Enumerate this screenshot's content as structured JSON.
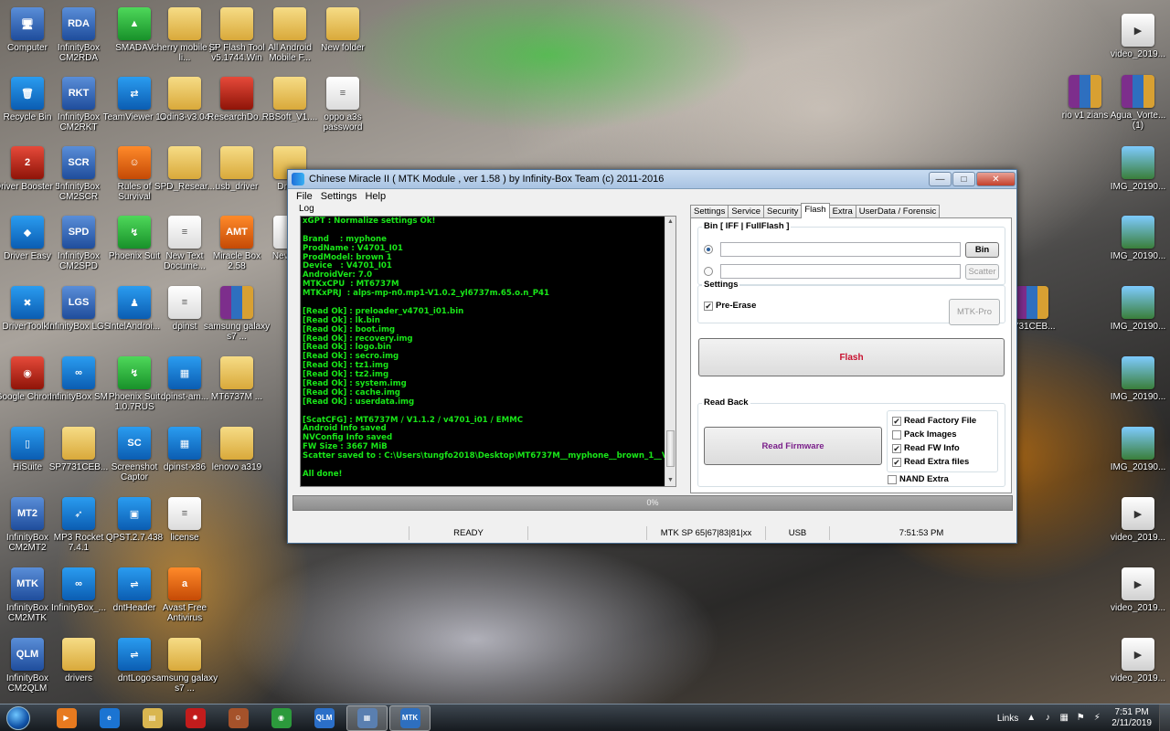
{
  "desktop_icons": [
    {
      "label": "Computer",
      "glyph": "🖥"
    },
    {
      "label": "InfinityBox CM2RDA",
      "glyph": "RDA"
    },
    {
      "label": "SMADAV",
      "glyph": "▲"
    },
    {
      "label": "cherry mobile j3 li...",
      "glyph": ""
    },
    {
      "label": "SP Flash Tool v5.1744.Win",
      "glyph": ""
    },
    {
      "label": "All Android Mobile F...",
      "glyph": ""
    },
    {
      "label": "New folder",
      "glyph": ""
    },
    {
      "label": "Recycle Bin",
      "glyph": "🗑"
    },
    {
      "label": "InfinityBox CM2RKT",
      "glyph": "RKT"
    },
    {
      "label": "TeamViewer 14",
      "glyph": "⇄"
    },
    {
      "label": "Odin3-v3.04",
      "glyph": ""
    },
    {
      "label": "ResearchDo...",
      "glyph": ""
    },
    {
      "label": "RBSoft_V1....",
      "glyph": ""
    },
    {
      "label": "oppo a3s password",
      "glyph": "≡"
    },
    {
      "label": "Driver Booster 5",
      "glyph": "2"
    },
    {
      "label": "InfinityBox CM2SCR",
      "glyph": "SCR"
    },
    {
      "label": "Rules of Survival",
      "glyph": "☺"
    },
    {
      "label": "SPD_Resear...",
      "glyph": ""
    },
    {
      "label": "usb_driver",
      "glyph": ""
    },
    {
      "label": "Drago",
      "glyph": ""
    },
    {
      "label": "Driver Easy",
      "glyph": "◆"
    },
    {
      "label": "InfinityBox CM2SPD",
      "glyph": "SPD"
    },
    {
      "label": "Phoenix Suit",
      "glyph": "↯"
    },
    {
      "label": "New Text Docume...",
      "glyph": "≡"
    },
    {
      "label": "Miracle Box 2.58",
      "glyph": "AMT"
    },
    {
      "label": "Nev Doc",
      "glyph": "≡"
    },
    {
      "label": "DriverToolkit",
      "glyph": "✖"
    },
    {
      "label": "InfinityBox LGS",
      "glyph": "LGS"
    },
    {
      "label": "IntelAndroi...",
      "glyph": "♟"
    },
    {
      "label": "dpinst",
      "glyph": "≡"
    },
    {
      "label": "samsung galaxy s7 ...",
      "glyph": ""
    },
    {
      "label": "Google Chrome",
      "glyph": "◉"
    },
    {
      "label": "InfinityBox SM",
      "glyph": "∞"
    },
    {
      "label": "Phoenix Suit 1.0.7RUS",
      "glyph": "↯"
    },
    {
      "label": "dpinst-am...",
      "glyph": "▦"
    },
    {
      "label": "MT6737M ...",
      "glyph": ""
    },
    {
      "label": "HiSuite",
      "glyph": "▯"
    },
    {
      "label": "SP7731CEB...",
      "glyph": ""
    },
    {
      "label": "Screenshot Captor",
      "glyph": "SC"
    },
    {
      "label": "dpinst-x86",
      "glyph": "▦"
    },
    {
      "label": "lenovo a319",
      "glyph": ""
    },
    {
      "label": "InfinityBox CM2MT2",
      "glyph": "MT2"
    },
    {
      "label": "MP3 Rocket 7.4.1",
      "glyph": "➶"
    },
    {
      "label": "QPST.2.7.438",
      "glyph": "▣"
    },
    {
      "label": "license",
      "glyph": "≡"
    },
    {
      "label": "InfinityBox CM2MTK",
      "glyph": "MTK"
    },
    {
      "label": "InfinityBox_...",
      "glyph": "∞"
    },
    {
      "label": "dntHeader",
      "glyph": "⇌"
    },
    {
      "label": "Avast Free Antivirus",
      "glyph": "a"
    },
    {
      "label": "InfinityBox CM2QLM",
      "glyph": "QLM"
    },
    {
      "label": "drivers",
      "glyph": ""
    },
    {
      "label": "dntLogo",
      "glyph": "⇌"
    },
    {
      "label": "samsung galaxy s7 ...",
      "glyph": ""
    },
    {
      "label": "video_2019...",
      "glyph": "▶"
    },
    {
      "label": "rio v1 zians",
      "glyph": ""
    },
    {
      "label": "Agua_Vorte... (1)",
      "glyph": ""
    },
    {
      "label": "IMG_20190...",
      "glyph": ""
    },
    {
      "label": "IMG_20190...",
      "glyph": ""
    },
    {
      "label": "7731CEB...",
      "glyph": ""
    },
    {
      "label": "IMG_20190...",
      "glyph": ""
    },
    {
      "label": "IMG_20190...",
      "glyph": ""
    },
    {
      "label": "IMG_20190...",
      "glyph": ""
    },
    {
      "label": "video_2019...",
      "glyph": "▶"
    },
    {
      "label": "video_2019...",
      "glyph": "▶"
    },
    {
      "label": "video_2019...",
      "glyph": "▶"
    }
  ],
  "window": {
    "title": "Chinese Miracle II ( MTK Module , ver 1.58 ) by Infinity-Box Team (c) 2011-2016",
    "minimize": "—",
    "maximize": "□",
    "close": "✕",
    "menu": [
      "File",
      "Settings",
      "Help"
    ],
    "log_label": "Log",
    "log_lines": [
      "xGPT : Normalize settings Ok!",
      "",
      "Brand    : myphone",
      "ProdName : V4701_I01",
      "ProdModel: brown 1",
      "Device   : V4701_I01",
      "AndroidVer: 7.0",
      "MTKxCPU  : MT6737M",
      "MTKxPRJ  : alps-mp-n0.mp1-V1.0.2_yl6737m.65.o.n_P41",
      "",
      "[Read Ok] : preloader_v4701_i01.bin",
      "[Read Ok] : lk.bin",
      "[Read Ok] : boot.img",
      "[Read Ok] : recovery.img",
      "[Read Ok] : logo.bin",
      "[Read Ok] : secro.img",
      "[Read Ok] : tz1.img",
      "[Read Ok] : tz2.img",
      "[Read Ok] : system.img",
      "[Read Ok] : cache.img",
      "[Read Ok] : userdata.img",
      "",
      "[ScatCFG] : MT6737M / V1.1.2 / v4701_i01 / EMMC",
      "Android Info saved",
      "NVConfig Info saved",
      "FW Size : 3667 MiB",
      "Scatter saved to : C:\\Users\\tungfo2018\\Desktop\\MT6737M__myphone__brown_1__V4701_",
      "",
      "All done!"
    ],
    "tabs": [
      "Settings",
      "Service",
      "Security",
      "Flash",
      "Extra",
      "UserData / Forensic"
    ],
    "active_tab": "Flash",
    "bin_group_label": "Bin  [ IFF | FullFlash ]",
    "bin_button": "Bin",
    "scatter_button": "Scatter",
    "settings_group_label": "Settings",
    "pre_erase_label": "Pre-Erase",
    "pre_erase_checked": true,
    "mtk_pro_button": "MTK-Pro",
    "flash_button": "Flash",
    "readback_group_label": "Read Back",
    "read_firmware_button": "Read Firmware",
    "readback_options": [
      {
        "label": "Read Factory File",
        "checked": true
      },
      {
        "label": "Pack Images",
        "checked": false
      },
      {
        "label": "Read FW Info",
        "checked": true
      },
      {
        "label": "Read Extra files",
        "checked": true
      }
    ],
    "nand_extra_label": "NAND Extra",
    "nand_extra_checked": false,
    "progress_text": "0%",
    "progress_value": 0,
    "status": {
      "blank": "",
      "state": "READY",
      "chip": "MTK SP 65|67|83|81|xx",
      "connection": "USB",
      "time": "7:51:53 PM"
    }
  },
  "taskbar": {
    "links_label": "Links",
    "time": "7:51 PM",
    "date": "2/11/2019",
    "items": [
      {
        "glyph": "▶",
        "active": false
      },
      {
        "glyph": "e",
        "active": false
      },
      {
        "glyph": "▤",
        "active": false
      },
      {
        "glyph": "✹",
        "active": false
      },
      {
        "glyph": "☺",
        "active": false
      },
      {
        "glyph": "◉",
        "active": false
      },
      {
        "glyph": "QLM",
        "active": false
      },
      {
        "glyph": "▦",
        "active": true
      },
      {
        "glyph": "MTK",
        "active": true
      }
    ]
  },
  "colors": {
    "log_text": "#19e619",
    "flash_button_text": "#c8102e",
    "read_firmware_text": "#7a1f8a"
  }
}
